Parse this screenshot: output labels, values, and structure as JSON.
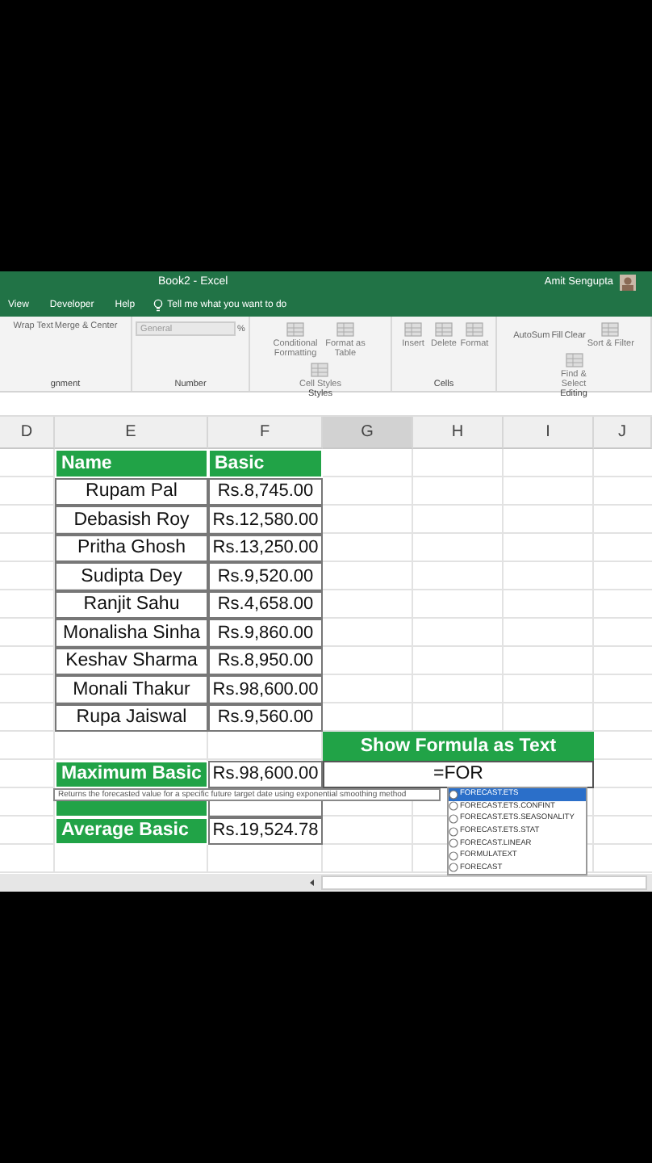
{
  "window": {
    "title": "Book2 - Excel",
    "user": "Amit Sengupta"
  },
  "ribbon_tabs": [
    {
      "label": "View",
      "selected": false
    },
    {
      "label": "Developer",
      "selected": false
    },
    {
      "label": "Help",
      "selected": false
    }
  ],
  "tell_me": "Tell me what you want to do",
  "ribbon_groups": [
    {
      "label": "gnment",
      "items": [
        {
          "label": "Wrap Text",
          "kind": "small"
        },
        {
          "label": "Merge & Center",
          "kind": "small"
        }
      ]
    },
    {
      "label": "Number",
      "items": [
        {
          "label": "General",
          "kind": "dropdown"
        },
        {
          "label": "%",
          "kind": "small"
        }
      ]
    },
    {
      "label": "Styles",
      "items": [
        {
          "label": "Conditional Formatting",
          "kind": "large"
        },
        {
          "label": "Format as Table",
          "kind": "large"
        },
        {
          "label": "Cell Styles",
          "kind": "large"
        }
      ]
    },
    {
      "label": "Cells",
      "items": [
        {
          "label": "Insert",
          "kind": "large"
        },
        {
          "label": "Delete",
          "kind": "large"
        },
        {
          "label": "Format",
          "kind": "large"
        }
      ]
    },
    {
      "label": "Editing",
      "items": [
        {
          "label": "AutoSum",
          "kind": "small"
        },
        {
          "label": "Fill",
          "kind": "small"
        },
        {
          "label": "Clear",
          "kind": "small"
        },
        {
          "label": "Sort & Filter",
          "kind": "large"
        },
        {
          "label": "Find & Select",
          "kind": "large"
        }
      ]
    }
  ],
  "columns": [
    {
      "label": "D",
      "selected": false
    },
    {
      "label": "E",
      "selected": false
    },
    {
      "label": "F",
      "selected": false
    },
    {
      "label": "G",
      "selected": true
    },
    {
      "label": "H",
      "selected": false
    },
    {
      "label": "I",
      "selected": false
    },
    {
      "label": "J",
      "selected": false
    }
  ],
  "table": {
    "headers": [
      "Name",
      "Basic"
    ],
    "rows": [
      {
        "name": "Rupam Pal",
        "basic": "Rs.8,745.00"
      },
      {
        "name": "Debasish Roy",
        "basic": "Rs.12,580.00"
      },
      {
        "name": "Pritha Ghosh",
        "basic": "Rs.13,250.00"
      },
      {
        "name": "Sudipta Dey",
        "basic": "Rs.9,520.00"
      },
      {
        "name": "Ranjit Sahu",
        "basic": "Rs.4,658.00"
      },
      {
        "name": "Monalisha Sinha",
        "basic": "Rs.9,860.00"
      },
      {
        "name": "Keshav Sharma",
        "basic": "Rs.8,950.00"
      },
      {
        "name": "Monali Thakur",
        "basic": "Rs.98,600.00"
      },
      {
        "name": "Rupa Jaiswal",
        "basic": "Rs.9,560.00"
      }
    ]
  },
  "formula_heading": "Show Formula as Text",
  "summary": [
    {
      "kind": "row",
      "label": "Maximum Basic",
      "value": "Rs.98,600.00"
    },
    {
      "kind": "covered"
    },
    {
      "kind": "row",
      "label": "Average Basic",
      "value": "Rs.19,524.78"
    }
  ],
  "formula_cell": {
    "value": "=FOR"
  },
  "tooltip": "Returns the forecasted value for a specific future target date using exponential smoothing method",
  "autocomplete": [
    {
      "label": "FORECAST.ETS",
      "selected": true
    },
    {
      "label": "FORECAST.ETS.CONFINT",
      "selected": false
    },
    {
      "label": "FORECAST.ETS.SEASONALITY",
      "selected": false
    },
    {
      "label": "FORECAST.ETS.STAT",
      "selected": false
    },
    {
      "label": "FORECAST.LINEAR",
      "selected": false
    },
    {
      "label": "FORMULATEXT",
      "selected": false
    },
    {
      "label": "FORECAST",
      "selected": false
    }
  ]
}
